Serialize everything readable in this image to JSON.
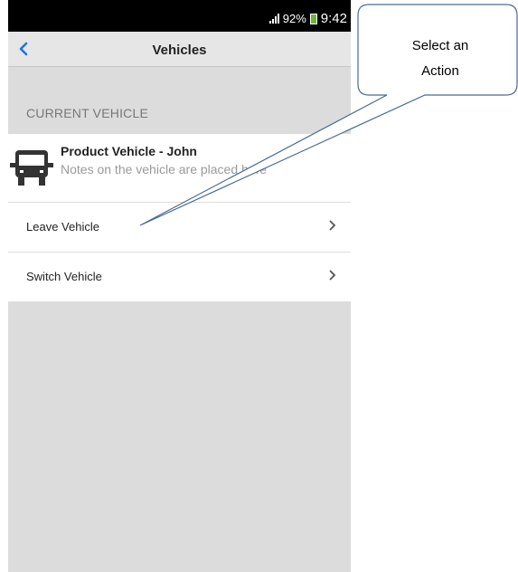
{
  "status_bar": {
    "battery": "92%",
    "time": "9:42"
  },
  "nav": {
    "title": "Vehicles",
    "back_icon": "chevron-left-icon"
  },
  "current_vehicle": {
    "section_header": "CURRENT VEHICLE",
    "name": "Product Vehicle - John",
    "notes": "Notes on the vehicle are placed here",
    "icon": "truck-icon"
  },
  "actions": [
    {
      "label": "Leave Vehicle"
    },
    {
      "label": "Switch Vehicle"
    }
  ],
  "callout": {
    "line1": "Select an",
    "line2": "Action"
  },
  "colors": {
    "accent": "#1a73e8",
    "status_bar": "#000000",
    "background": "#dcdcdc",
    "battery": "#6fb33a"
  }
}
